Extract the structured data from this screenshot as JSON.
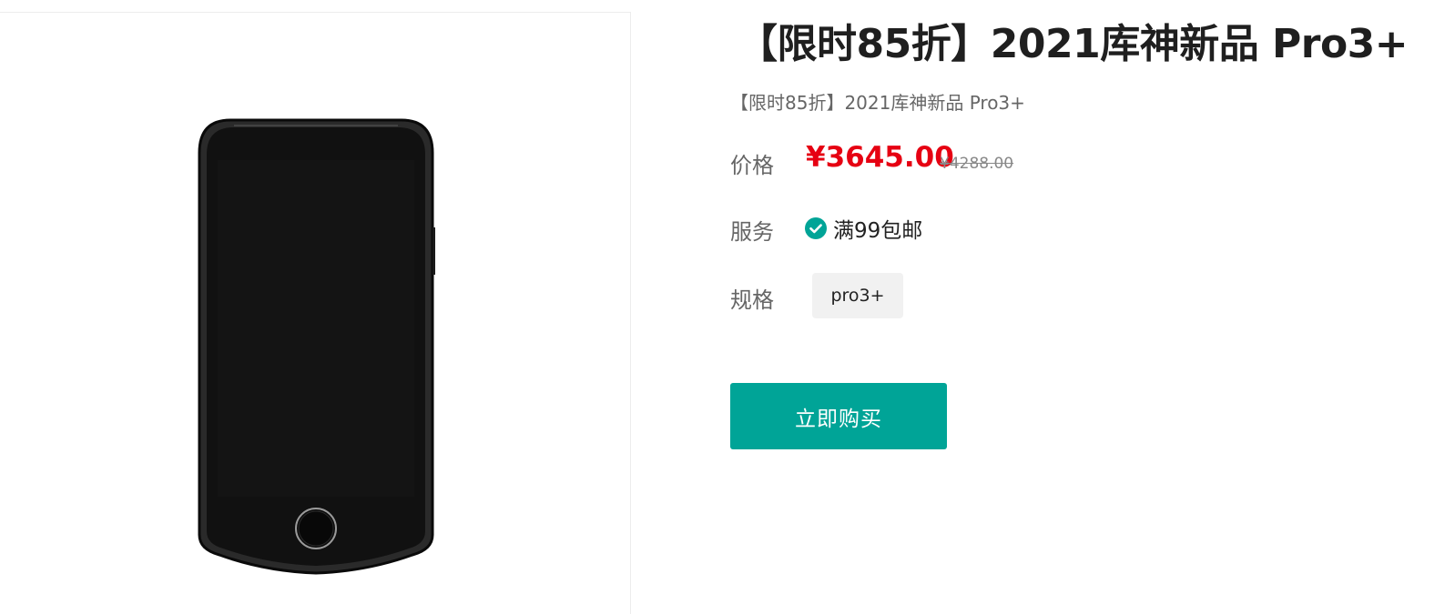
{
  "product": {
    "title": "【限时85折】2021库神新品 Pro3+",
    "subtitle": "【限时85折】2021库神新品 Pro3+",
    "image_icon": "phone-device-image"
  },
  "price": {
    "label": "价格",
    "current": "¥3645.00",
    "original": "¥4288.00",
    "current_color": "#e60012"
  },
  "service": {
    "label": "服务",
    "value": "满99包邮",
    "icon": "check-circle-icon",
    "icon_color": "#00a497"
  },
  "spec": {
    "label": "规格",
    "options": [
      "pro3+"
    ]
  },
  "actions": {
    "buy_label": "立即购买",
    "buy_color": "#00a497"
  }
}
